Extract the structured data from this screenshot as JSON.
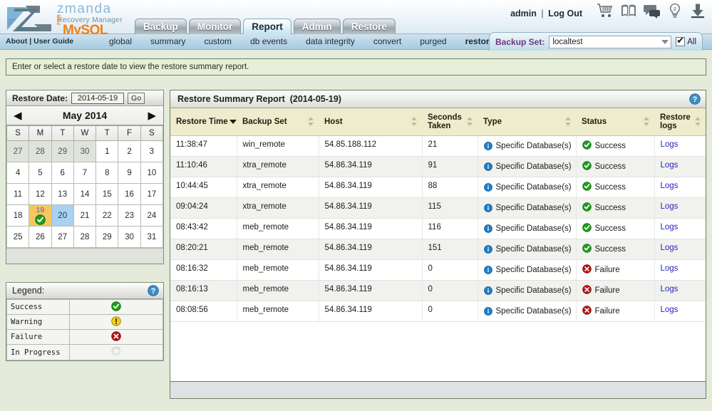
{
  "brand": {
    "zmanda": "zmanda",
    "recovery_manager": "Recovery Manager",
    "for": "FOR",
    "mysql": "MySQL"
  },
  "header": {
    "user": "admin",
    "separator": "|",
    "logout": "Log Out",
    "icons": [
      "cart-icon",
      "book-icon",
      "chat-icon",
      "lightbulb-icon",
      "download-icon"
    ],
    "tabs": [
      {
        "label": "Backup",
        "active": false
      },
      {
        "label": "Monitor",
        "active": false
      },
      {
        "label": "Report",
        "active": true
      },
      {
        "label": "Admin",
        "active": false
      },
      {
        "label": "Restore",
        "active": false
      }
    ]
  },
  "subnav": {
    "about": "About",
    "sep": "|",
    "user_guide": "User Guide",
    "items": [
      {
        "label": "global",
        "active": false
      },
      {
        "label": "summary",
        "active": false
      },
      {
        "label": "custom",
        "active": false
      },
      {
        "label": "db events",
        "active": false
      },
      {
        "label": "data integrity",
        "active": false
      },
      {
        "label": "convert",
        "active": false
      },
      {
        "label": "purged",
        "active": false
      },
      {
        "label": "restore",
        "active": true
      }
    ]
  },
  "backup_set": {
    "label": "Backup Set:",
    "value": "localtest",
    "all_label": "All",
    "all_checked": true
  },
  "banner": {
    "text": "Enter or select a restore date to view the restore summary report."
  },
  "calendar": {
    "restore_date_label": "Restore Date:",
    "restore_date_value": "2014-05-19",
    "go_label": "Go",
    "prev_arrow": "◀",
    "next_arrow": "▶",
    "month_title": "May 2014",
    "weekdays": [
      "S",
      "M",
      "T",
      "W",
      "T",
      "F",
      "S"
    ],
    "weeks": [
      [
        {
          "d": "27",
          "state": "out"
        },
        {
          "d": "28",
          "state": "out"
        },
        {
          "d": "29",
          "state": "out"
        },
        {
          "d": "30",
          "state": "out"
        },
        {
          "d": "1",
          "state": ""
        },
        {
          "d": "2",
          "state": ""
        },
        {
          "d": "3",
          "state": ""
        }
      ],
      [
        {
          "d": "4",
          "state": ""
        },
        {
          "d": "5",
          "state": ""
        },
        {
          "d": "6",
          "state": ""
        },
        {
          "d": "7",
          "state": ""
        },
        {
          "d": "8",
          "state": ""
        },
        {
          "d": "9",
          "state": ""
        },
        {
          "d": "10",
          "state": ""
        }
      ],
      [
        {
          "d": "11",
          "state": ""
        },
        {
          "d": "12",
          "state": ""
        },
        {
          "d": "13",
          "state": ""
        },
        {
          "d": "14",
          "state": ""
        },
        {
          "d": "15",
          "state": ""
        },
        {
          "d": "16",
          "state": ""
        },
        {
          "d": "17",
          "state": ""
        }
      ],
      [
        {
          "d": "18",
          "state": ""
        },
        {
          "d": "19",
          "state": "evt",
          "status": "success"
        },
        {
          "d": "20",
          "state": "sel"
        },
        {
          "d": "21",
          "state": ""
        },
        {
          "d": "22",
          "state": ""
        },
        {
          "d": "23",
          "state": ""
        },
        {
          "d": "24",
          "state": ""
        }
      ],
      [
        {
          "d": "25",
          "state": ""
        },
        {
          "d": "26",
          "state": ""
        },
        {
          "d": "27",
          "state": ""
        },
        {
          "d": "28",
          "state": ""
        },
        {
          "d": "29",
          "state": ""
        },
        {
          "d": "30",
          "state": ""
        },
        {
          "d": "31",
          "state": ""
        }
      ]
    ]
  },
  "legend": {
    "title": "Legend:",
    "help_icon": "help-icon",
    "rows": [
      {
        "label": "Success",
        "icon": "success-icon"
      },
      {
        "label": "Warning",
        "icon": "warning-icon"
      },
      {
        "label": "Failure",
        "icon": "failure-icon"
      },
      {
        "label": "In Progress",
        "icon": "in-progress-icon"
      }
    ]
  },
  "report": {
    "title": "Restore Summary Report",
    "date": "(2014-05-19)",
    "help_icon": "help-icon",
    "columns": [
      {
        "label": "Restore Time",
        "sort": "desc"
      },
      {
        "label": "Backup Set",
        "sort": "both"
      },
      {
        "label": "Host",
        "sort": "both"
      },
      {
        "label": "Seconds Taken",
        "sort": "both"
      },
      {
        "label": "Type",
        "sort": "both"
      },
      {
        "label": "Status",
        "sort": "both"
      },
      {
        "label": "Restore logs",
        "sort": "both"
      }
    ],
    "rows": [
      {
        "time": "11:38:47",
        "backup_set": "win_remote",
        "host": "54.85.188.112",
        "seconds": "21",
        "type": "Specific Database(s)",
        "status": "Success",
        "status_kind": "success",
        "logs": "Logs"
      },
      {
        "time": "11:10:46",
        "backup_set": "xtra_remote",
        "host": "54.86.34.119",
        "seconds": "91",
        "type": "Specific Database(s)",
        "status": "Success",
        "status_kind": "success",
        "logs": "Logs"
      },
      {
        "time": "10:44:45",
        "backup_set": "xtra_remote",
        "host": "54.86.34.119",
        "seconds": "88",
        "type": "Specific Database(s)",
        "status": "Success",
        "status_kind": "success",
        "logs": "Logs"
      },
      {
        "time": "09:04:24",
        "backup_set": "xtra_remote",
        "host": "54.86.34.119",
        "seconds": "115",
        "type": "Specific Database(s)",
        "status": "Success",
        "status_kind": "success",
        "logs": "Logs"
      },
      {
        "time": "08:43:42",
        "backup_set": "meb_remote",
        "host": "54.86.34.119",
        "seconds": "116",
        "type": "Specific Database(s)",
        "status": "Success",
        "status_kind": "success",
        "logs": "Logs"
      },
      {
        "time": "08:20:21",
        "backup_set": "meb_remote",
        "host": "54.86.34.119",
        "seconds": "151",
        "type": "Specific Database(s)",
        "status": "Success",
        "status_kind": "success",
        "logs": "Logs"
      },
      {
        "time": "08:16:32",
        "backup_set": "meb_remote",
        "host": "54.86.34.119",
        "seconds": "0",
        "type": "Specific Database(s)",
        "status": "Failure",
        "status_kind": "failure",
        "logs": "Logs"
      },
      {
        "time": "08:16:13",
        "backup_set": "meb_remote",
        "host": "54.86.34.119",
        "seconds": "0",
        "type": "Specific Database(s)",
        "status": "Failure",
        "status_kind": "failure",
        "logs": "Logs"
      },
      {
        "time": "08:08:56",
        "backup_set": "meb_remote",
        "host": "54.86.34.119",
        "seconds": "0",
        "type": "Specific Database(s)",
        "status": "Failure",
        "status_kind": "failure",
        "logs": "Logs"
      }
    ]
  },
  "colors": {
    "brand_orange": "#f07f13",
    "brand_blue": "#8bb9d6",
    "success_green": "#1f9e1f",
    "failure_red": "#b81414",
    "warning_yellow": "#f2cf14",
    "info_blue": "#1c7ec9",
    "link_blue": "#2626bb",
    "header_tan": "#eeeccd",
    "page_bg": "#e4ebdb"
  }
}
